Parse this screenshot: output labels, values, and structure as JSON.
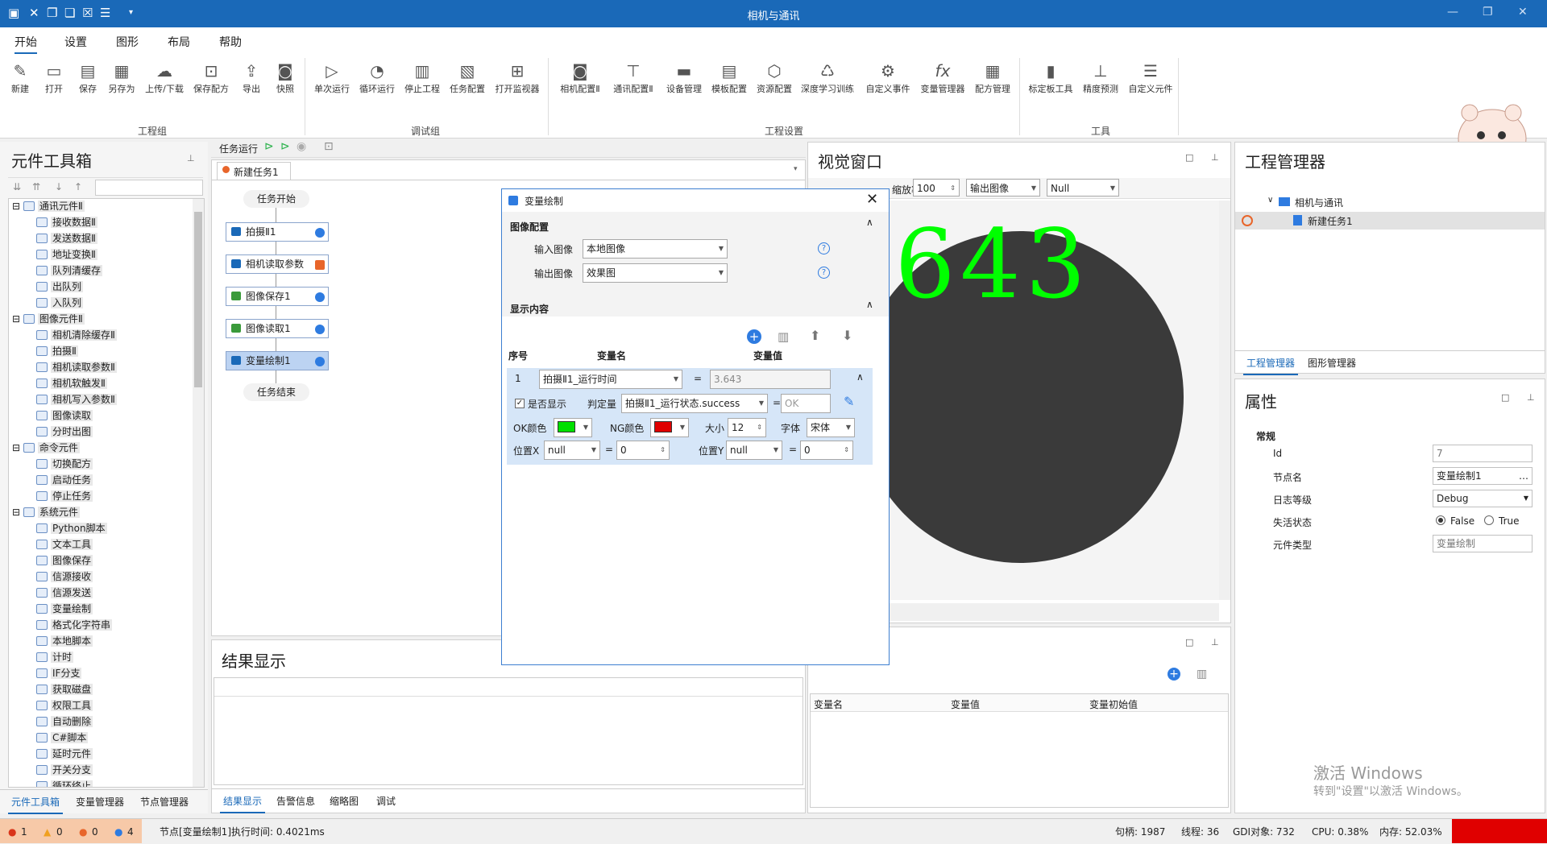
{
  "window": {
    "title": "相机与通讯"
  },
  "menu": [
    "开始",
    "设置",
    "图形",
    "布局",
    "帮助"
  ],
  "ribbon": {
    "groups": [
      "工程组",
      "调试组",
      "工程设置",
      "工具"
    ],
    "buttons": [
      "新建",
      "打开",
      "保存",
      "另存为",
      "上传/下载",
      "保存配方",
      "导出",
      "快照",
      "单次运行",
      "循环运行",
      "停止工程",
      "任务配置",
      "打开监视器",
      "相机配置Ⅱ",
      "通讯配置Ⅱ",
      "设备管理",
      "模板配置",
      "资源配置",
      "深度学习训练",
      "自定义事件",
      "变量管理器",
      "配方管理",
      "标定板工具",
      "精度预测",
      "自定义元件"
    ]
  },
  "toolbox": {
    "title": "元件工具箱",
    "items": [
      {
        "label": "通讯元件Ⅱ",
        "level": 0
      },
      {
        "label": "接收数据Ⅱ",
        "level": 1
      },
      {
        "label": "发送数据Ⅱ",
        "level": 1
      },
      {
        "label": "地址变换Ⅱ",
        "level": 1
      },
      {
        "label": "队列清缓存",
        "level": 1
      },
      {
        "label": "出队列",
        "level": 1
      },
      {
        "label": "入队列",
        "level": 1
      },
      {
        "label": "图像元件Ⅱ",
        "level": 0
      },
      {
        "label": "相机清除缓存Ⅱ",
        "level": 1
      },
      {
        "label": "拍摄Ⅱ",
        "level": 1
      },
      {
        "label": "相机读取参数Ⅱ",
        "level": 1
      },
      {
        "label": "相机软触发Ⅱ",
        "level": 1
      },
      {
        "label": "相机写入参数Ⅱ",
        "level": 1
      },
      {
        "label": "图像读取",
        "level": 1
      },
      {
        "label": "分时出图",
        "level": 1
      },
      {
        "label": "命令元件",
        "level": 0
      },
      {
        "label": "切换配方",
        "level": 1
      },
      {
        "label": "启动任务",
        "level": 1
      },
      {
        "label": "停止任务",
        "level": 1
      },
      {
        "label": "系统元件",
        "level": 0
      },
      {
        "label": "Python脚本",
        "level": 1
      },
      {
        "label": "文本工具",
        "level": 1
      },
      {
        "label": "图像保存",
        "level": 1
      },
      {
        "label": "信源接收",
        "level": 1
      },
      {
        "label": "信源发送",
        "level": 1
      },
      {
        "label": "变量绘制",
        "level": 1
      },
      {
        "label": "格式化字符串",
        "level": 1
      },
      {
        "label": "本地脚本",
        "level": 1
      },
      {
        "label": "计时",
        "level": 1
      },
      {
        "label": "IF分支",
        "level": 1
      },
      {
        "label": "获取磁盘",
        "level": 1
      },
      {
        "label": "权限工具",
        "level": 1
      },
      {
        "label": "自动删除",
        "level": 1
      },
      {
        "label": "C#脚本",
        "level": 1
      },
      {
        "label": "延时元件",
        "level": 1
      },
      {
        "label": "开关分支",
        "level": 1
      },
      {
        "label": "循环终止",
        "level": 1
      }
    ],
    "tabs": [
      "元件工具箱",
      "变量管理器",
      "节点管理器"
    ]
  },
  "task": {
    "run_label": "任务运行",
    "tab": "新建任务1",
    "start": "任务开始",
    "end": "任务结束",
    "nodes": [
      "拍摄Ⅱ1",
      "相机读取参数",
      "图像保存1",
      "图像读取1",
      "变量绘制1"
    ]
  },
  "result": {
    "title": "结果显示",
    "tabs": [
      "结果显示",
      "告警信息",
      "缩略图",
      "调试"
    ]
  },
  "vision": {
    "title": "视觉窗口",
    "zoom_label": "缩放率",
    "zoom": "100",
    "image_select": "输出图像",
    "null_select": "Null",
    "overlay_text": ".643"
  },
  "dialog": {
    "title": "变量绘制",
    "image_section": "图像配置",
    "input_label": "输入图像",
    "input_value": "本地图像",
    "output_label": "输出图像",
    "output_value": "效果图",
    "content_section": "显示内容",
    "col_index": "序号",
    "col_name": "变量名",
    "col_value": "变量值",
    "row": {
      "index": "1",
      "var": "拍摄Ⅱ1_运行时间",
      "eq": "=",
      "value": "3.643",
      "show_label": "是否显示",
      "judge_label": "判定量",
      "judge_value": "拍摄Ⅱ1_运行状态.success",
      "judge_result": "OK",
      "ok_label": "OK颜色",
      "ng_label": "NG颜色",
      "size_label": "大小",
      "size": "12",
      "font_label": "字体",
      "font": "宋体",
      "posx_label": "位置X",
      "posx_var": "null",
      "posx": "0",
      "posy_label": "位置Y",
      "posy_var": "null",
      "posy": "0"
    }
  },
  "var_table": {
    "cols": [
      "变量名",
      "变量值",
      "变量初始值"
    ]
  },
  "project": {
    "title": "工程管理器",
    "root": "相机与通讯",
    "child": "新建任务1",
    "tabs": [
      "工程管理器",
      "图形管理器"
    ]
  },
  "properties": {
    "title": "属性",
    "section": "常规",
    "id_label": "Id",
    "id": "7",
    "name_label": "节点名",
    "name": "变量绘制1",
    "log_label": "日志等级",
    "log": "Debug",
    "enable_label": "失活状态",
    "false": "False",
    "true": "True",
    "type_label": "元件类型",
    "type": "变量绘制"
  },
  "watermark": {
    "line1": "激活 Windows",
    "line2": "转到\"设置\"以激活 Windows。"
  },
  "status": {
    "err": "1",
    "warn": "0",
    "orange": "0",
    "blue": "4",
    "message": "节点[变量绘制1]执行时间: 0.4021ms",
    "handles": "句柄: 1987",
    "threads": "线程: 36",
    "gdi": "GDI对象: 732",
    "cpu": "CPU: 0.38%",
    "mem": "内存: 52.03%"
  },
  "colors": {
    "accent": "#1a69b8",
    "ok": "#00e000",
    "ng": "#e00000",
    "overlay": "#00ff00"
  }
}
